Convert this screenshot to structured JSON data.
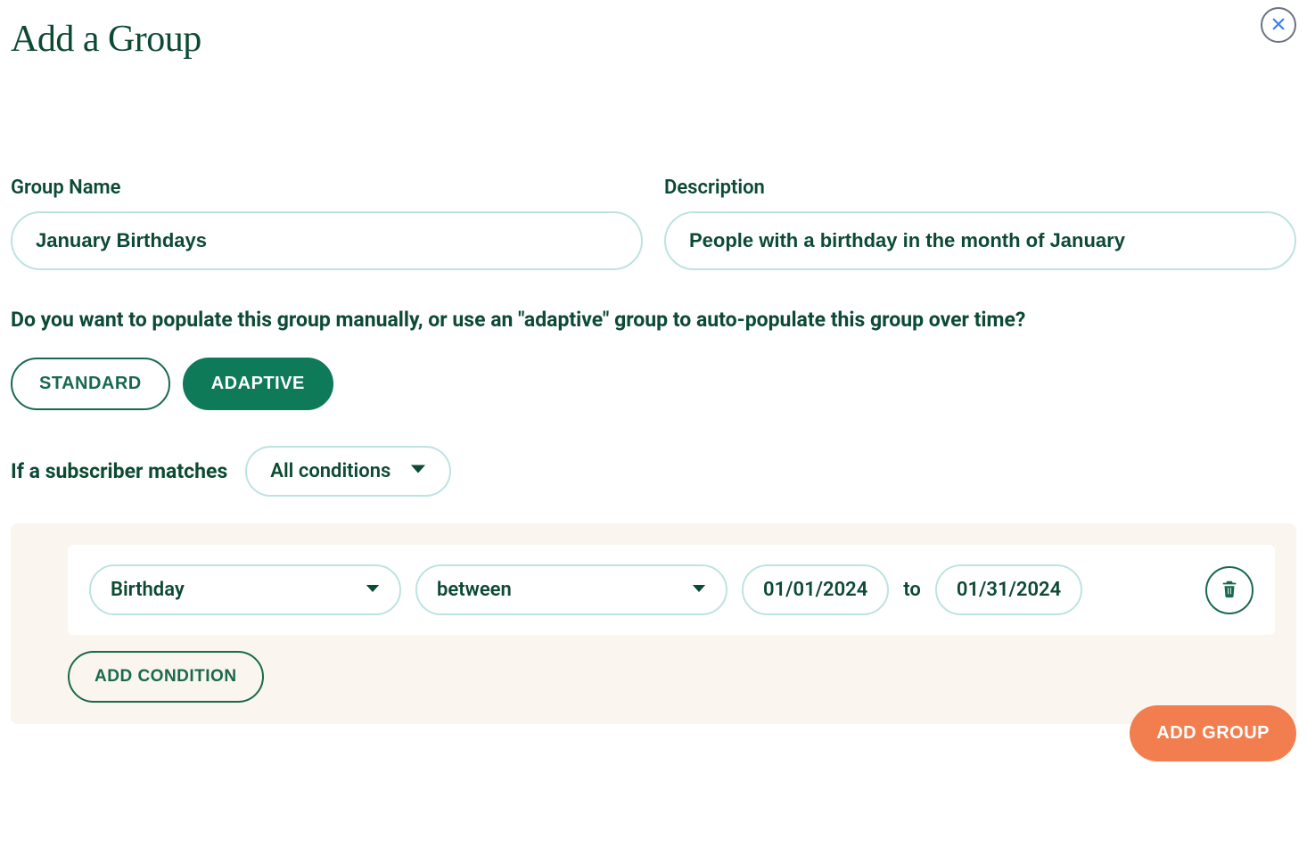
{
  "title": "Add a Group",
  "close_aria": "Close",
  "fields": {
    "group_name": {
      "label": "Group Name",
      "value": "January Birthdays"
    },
    "description": {
      "label": "Description",
      "value": "People with a birthday in the month of January"
    }
  },
  "question": "Do you want to populate this group manually, or use an \"adaptive\" group to auto-populate this group over time?",
  "group_type": {
    "options": [
      {
        "label": "STANDARD",
        "active": false
      },
      {
        "label": "ADAPTIVE",
        "active": true
      }
    ]
  },
  "match": {
    "prefix": "If a subscriber matches",
    "selected": "All conditions"
  },
  "conditions": [
    {
      "field": "Birthday",
      "operator": "between",
      "from": "01/01/2024",
      "to_label": "to",
      "to": "01/31/2024"
    }
  ],
  "buttons": {
    "add_condition": "ADD CONDITION",
    "add_group": "ADD GROUP"
  }
}
